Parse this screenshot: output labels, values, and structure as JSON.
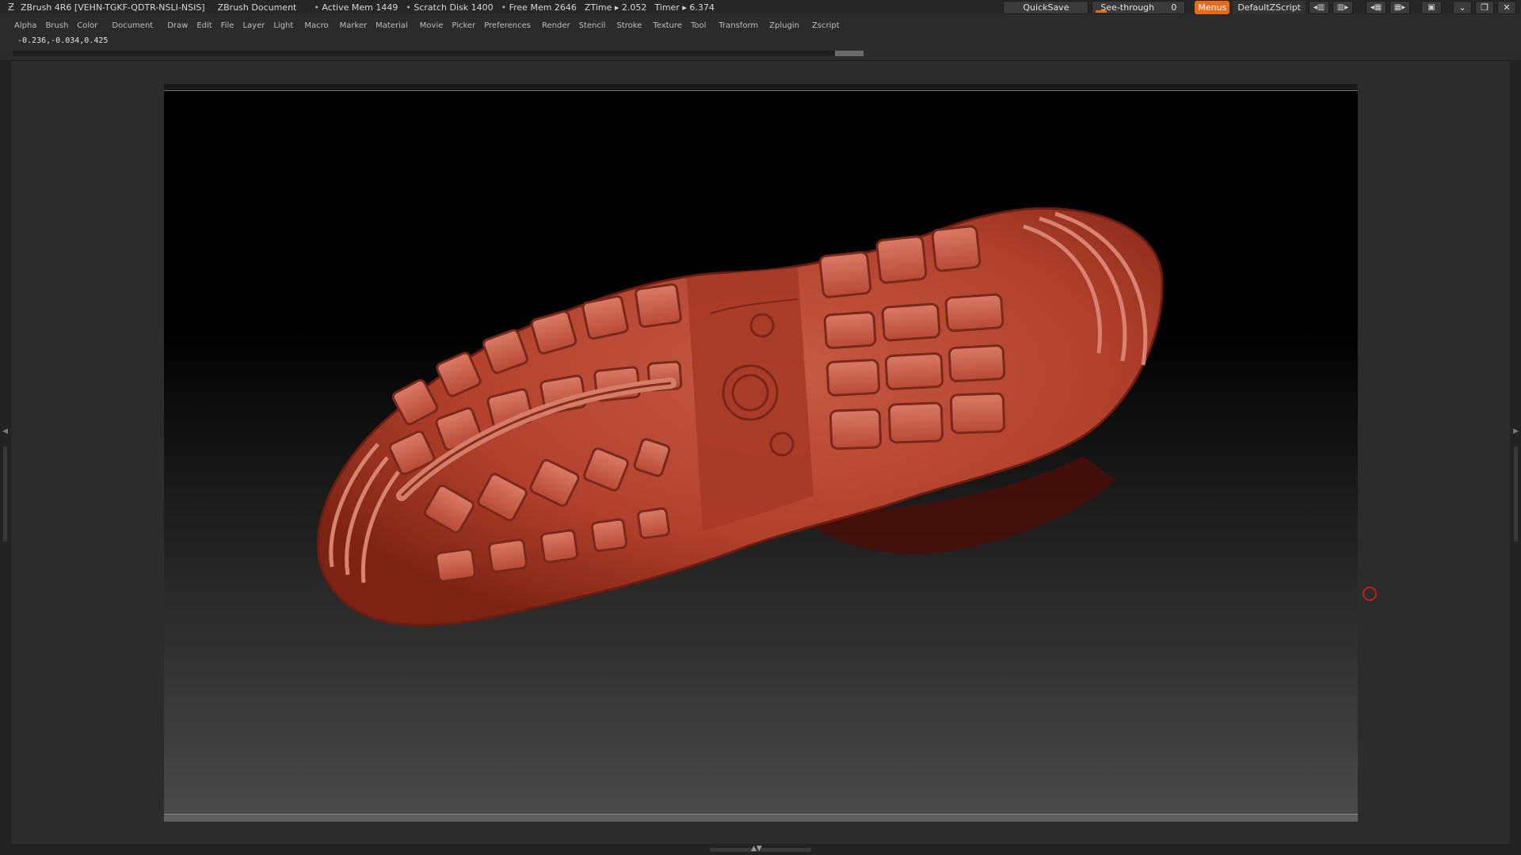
{
  "titlebar": {
    "app": "ZBrush 4R6 [VEHN-TGKF-QDTR-NSLI-NSIS]",
    "document": "ZBrush Document",
    "active_mem": "Active Mem 1449",
    "scratch_disk": "Scratch Disk 1400",
    "free_mem": "Free Mem 2646",
    "ztime": "ZTime ▸ 2.052",
    "timer": "Timer ▸ 6.374",
    "quicksave": "QuickSave",
    "seethrough_label": "See-through",
    "seethrough_value": "0",
    "menus": "Menus",
    "default_script": "DefaultZScript"
  },
  "menubar": {
    "items": [
      "Alpha",
      "Brush",
      "Color",
      "Document",
      "Draw",
      "Edit",
      "File",
      "Layer",
      "Light",
      "Macro",
      "Marker",
      "Material",
      "Movie",
      "Picker",
      "Preferences",
      "Render",
      "Stencil",
      "Stroke",
      "Texture",
      "Tool",
      "Transform",
      "Zplugin",
      "Zscript"
    ]
  },
  "coords": "-0.236,-0.034,0.425",
  "colors": {
    "accent": "#e86b1a",
    "model": "#b6412e",
    "cursor": "#c0201e"
  },
  "icons": {
    "zbrush-logo": "Z",
    "minimize": "⌄",
    "restore": "❐",
    "close": "✕"
  }
}
